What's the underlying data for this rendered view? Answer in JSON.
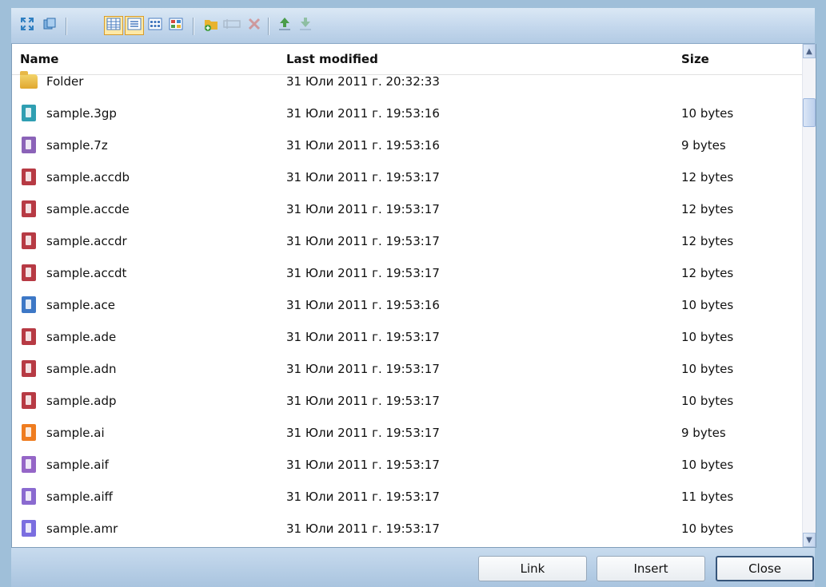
{
  "toolbar": {
    "buttons": [
      {
        "icon": "expand-icon",
        "color": "#3b82c4"
      },
      {
        "icon": "refresh-icon",
        "color": "#3b82c4"
      },
      {
        "icon": "thumbnails-view-icon",
        "color": "#4a7cc0",
        "active": true
      },
      {
        "icon": "list-view-icon",
        "color": "#4a7cc0",
        "active": true
      },
      {
        "icon": "details-view-icon",
        "color": "#4a7cc0"
      },
      {
        "icon": "tiles-view-icon",
        "color": "#d5473d"
      },
      {
        "icon": "new-folder-icon",
        "color": "#e8b32f"
      },
      {
        "icon": "rename-icon",
        "color": "#9aa7b6",
        "disabled": true
      },
      {
        "icon": "delete-icon",
        "color": "#d64b3c",
        "disabled": true
      },
      {
        "icon": "upload-icon",
        "color": "#4a9d4a"
      },
      {
        "icon": "download-icon",
        "color": "#4a9d4a",
        "disabled": true
      }
    ]
  },
  "grid": {
    "columns": {
      "name": "Name",
      "modified": "Last modified",
      "size": "Size"
    },
    "rows": [
      {
        "name": "Folder",
        "modified": "31 Юли 2011 г. 20:32:33",
        "size": "",
        "type": "folder",
        "color": "#e7b848"
      },
      {
        "name": "sample.3gp",
        "modified": "31 Юли 2011 г. 19:53:16",
        "size": "10 bytes",
        "type": "video",
        "color": "#2f9fb2"
      },
      {
        "name": "sample.7z",
        "modified": "31 Юли 2011 г. 19:53:16",
        "size": "9 bytes",
        "type": "archive",
        "color": "#8b63b8"
      },
      {
        "name": "sample.accdb",
        "modified": "31 Юли 2011 г. 19:53:17",
        "size": "12 bytes",
        "type": "access",
        "color": "#b73a44"
      },
      {
        "name": "sample.accde",
        "modified": "31 Юли 2011 г. 19:53:17",
        "size": "12 bytes",
        "type": "access",
        "color": "#b73a44"
      },
      {
        "name": "sample.accdr",
        "modified": "31 Юли 2011 г. 19:53:17",
        "size": "12 bytes",
        "type": "access",
        "color": "#b73a44"
      },
      {
        "name": "sample.accdt",
        "modified": "31 Юли 2011 г. 19:53:17",
        "size": "12 bytes",
        "type": "access",
        "color": "#b73a44"
      },
      {
        "name": "sample.ace",
        "modified": "31 Юли 2011 г. 19:53:16",
        "size": "10 bytes",
        "type": "archive",
        "color": "#3d78c6"
      },
      {
        "name": "sample.ade",
        "modified": "31 Юли 2011 г. 19:53:17",
        "size": "10 bytes",
        "type": "access",
        "color": "#b73a44"
      },
      {
        "name": "sample.adn",
        "modified": "31 Юли 2011 г. 19:53:17",
        "size": "10 bytes",
        "type": "access",
        "color": "#b73a44"
      },
      {
        "name": "sample.adp",
        "modified": "31 Юли 2011 г. 19:53:17",
        "size": "10 bytes",
        "type": "access",
        "color": "#b73a44"
      },
      {
        "name": "sample.ai",
        "modified": "31 Юли 2011 г. 19:53:17",
        "size": "9 bytes",
        "type": "illustrator",
        "color": "#ef7c1f"
      },
      {
        "name": "sample.aif",
        "modified": "31 Юли 2011 г. 19:53:17",
        "size": "10 bytes",
        "type": "audio",
        "color": "#9566c7"
      },
      {
        "name": "sample.aiff",
        "modified": "31 Юли 2011 г. 19:53:17",
        "size": "11 bytes",
        "type": "audio",
        "color": "#8a6ad0"
      },
      {
        "name": "sample.amr",
        "modified": "31 Юли 2011 г. 19:53:17",
        "size": "10 bytes",
        "type": "audio",
        "color": "#7b6ee0"
      }
    ]
  },
  "scrollbar": {
    "up": "▲",
    "down": "▼"
  },
  "footer": {
    "link": "Link",
    "insert": "Insert",
    "close": "Close"
  }
}
